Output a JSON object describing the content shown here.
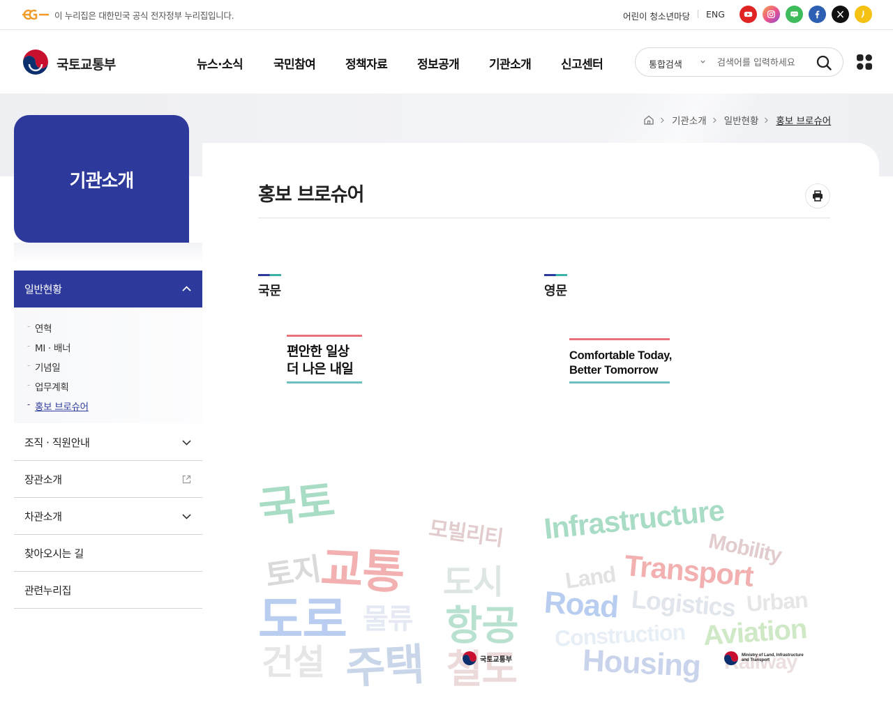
{
  "govbar": {
    "notice": "이 누리집은 대한민국 공식 전자정부 누리집입니다.",
    "kids_link": "어린이 청소년마당",
    "eng_link": "ENG",
    "sns": [
      {
        "name": "youtube",
        "color": "#e02424"
      },
      {
        "name": "instagram",
        "color": "#e8508f"
      },
      {
        "name": "blog",
        "color": "#3ebb5a"
      },
      {
        "name": "facebook",
        "color": "#2d5fb3"
      },
      {
        "name": "x",
        "color": "#111111"
      },
      {
        "name": "kakao",
        "color": "#f5c113"
      }
    ]
  },
  "header": {
    "logo_text": "국토교통부",
    "gnb": [
      "뉴스·소식",
      "국민참여",
      "정책자료",
      "정보공개",
      "기관소개",
      "신고센터"
    ],
    "search": {
      "scope": "통합검색",
      "placeholder": "검색어를 입력하세요"
    }
  },
  "breadcrumb": {
    "items": [
      "기관소개",
      "일반현황"
    ],
    "current": "홍보 브로슈어"
  },
  "lnb": {
    "title": "기관소개",
    "active": "일반현황",
    "sub_items": [
      "연혁",
      "MI · 배너",
      "기념일",
      "업무계획",
      "홍보 브로슈어"
    ],
    "sub_current_index": 4,
    "items": [
      {
        "label": "조직 · 직원안내",
        "icon": "chevron-down-icon"
      },
      {
        "label": "장관소개",
        "icon": "external-link-icon"
      },
      {
        "label": "차관소개",
        "icon": "chevron-down-icon"
      },
      {
        "label": "찾아오시는 길",
        "icon": ""
      },
      {
        "label": "관련누리집",
        "icon": ""
      }
    ]
  },
  "content": {
    "title": "홍보 브로슈어",
    "sections": [
      {
        "label": "국문",
        "brochure_lines": [
          "편안한 일상",
          "더 나은 내일"
        ],
        "cloud_words": [
          "국토",
          "모빌리티",
          "토지",
          "교통",
          "도시",
          "도로",
          "물류",
          "항공",
          "건설",
          "주택",
          "철도"
        ],
        "cloud_logo": "국토교통부"
      },
      {
        "label": "영문",
        "brochure_lines": [
          "Comfortable Today,",
          "Better Tomorrow"
        ],
        "cloud_words": [
          "Infrastructure",
          "Mobility",
          "Land",
          "Transport",
          "Road",
          "Logistics",
          "Urban",
          "Construction",
          "Aviation",
          "Housing",
          "Railway"
        ],
        "cloud_logo": "Ministry of Land, Infrastructure and Transport"
      }
    ]
  },
  "colors": {
    "primary": "#2e3a9b",
    "accent_red": "#e8737a",
    "accent_teal": "#6cc0bd"
  }
}
